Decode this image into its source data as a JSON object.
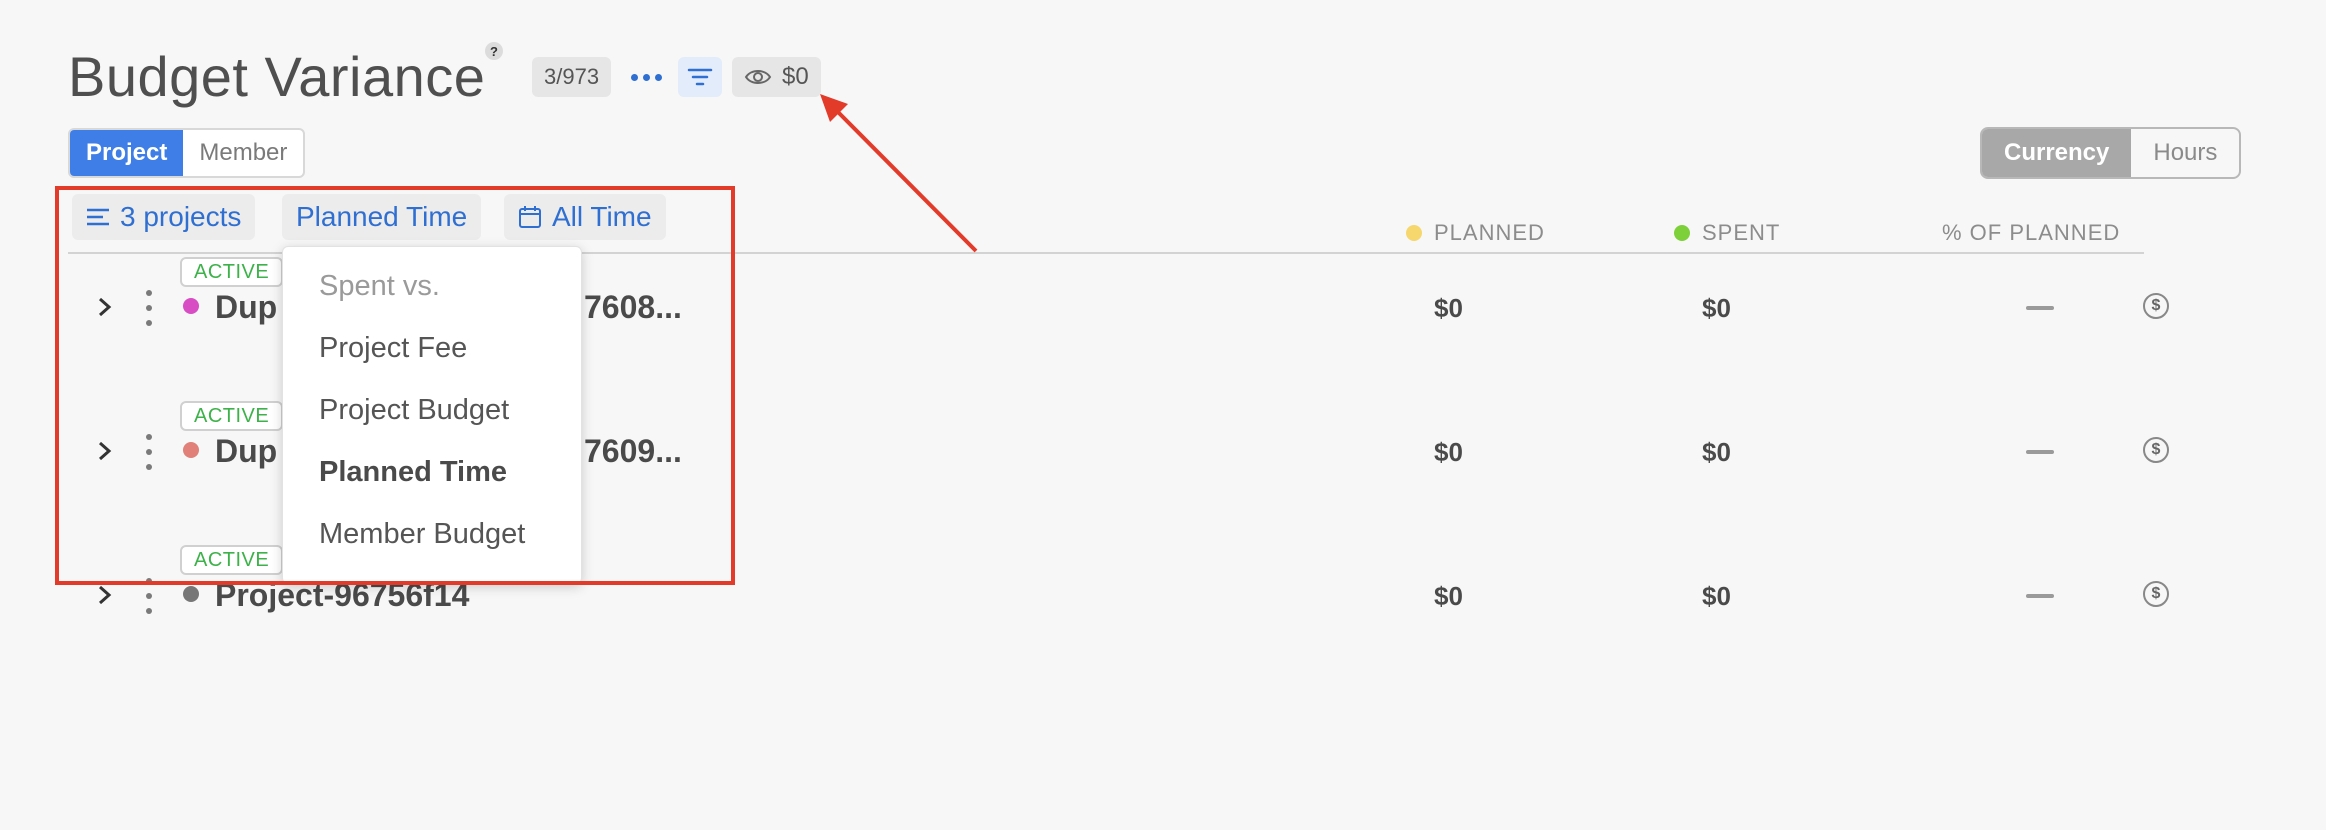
{
  "header": {
    "title": "Budget Variance",
    "help_glyph": "?",
    "count": "3/973",
    "eye_value": "$0"
  },
  "view_toggle": {
    "project": "Project",
    "member": "Member",
    "selected": "Project"
  },
  "unit_toggle": {
    "currency": "Currency",
    "hours": "Hours",
    "selected": "Currency"
  },
  "filters": {
    "projects": "3 projects",
    "comparison": "Planned Time",
    "date_range": "All Time"
  },
  "columns": {
    "planned": "PLANNED",
    "spent": "SPENT",
    "pct": "% OF PLANNED",
    "planned_color": "#f5d76e",
    "spent_color": "#7ed03a"
  },
  "rows": [
    {
      "status": "ACTIVE",
      "name_start": "Dup",
      "name_end": "7608...",
      "dot_color": "#d94dc4",
      "planned": "$0",
      "spent": "$0"
    },
    {
      "status": "ACTIVE",
      "name_start": "Dup",
      "name_end": "7609...",
      "dot_color": "#e08079",
      "planned": "$0",
      "spent": "$0"
    },
    {
      "status": "ACTIVE",
      "name": "Project-96756f14",
      "dot_color": "#777777",
      "planned": "$0",
      "spent": "$0"
    }
  ],
  "dropdown": {
    "header": "Spent vs.",
    "items": [
      "Project Fee",
      "Project Budget",
      "Planned Time",
      "Member Budget"
    ],
    "selected": "Planned Time"
  },
  "annotation": {
    "color": "#e33b2a"
  },
  "icons": {
    "coin_glyph": "$"
  }
}
